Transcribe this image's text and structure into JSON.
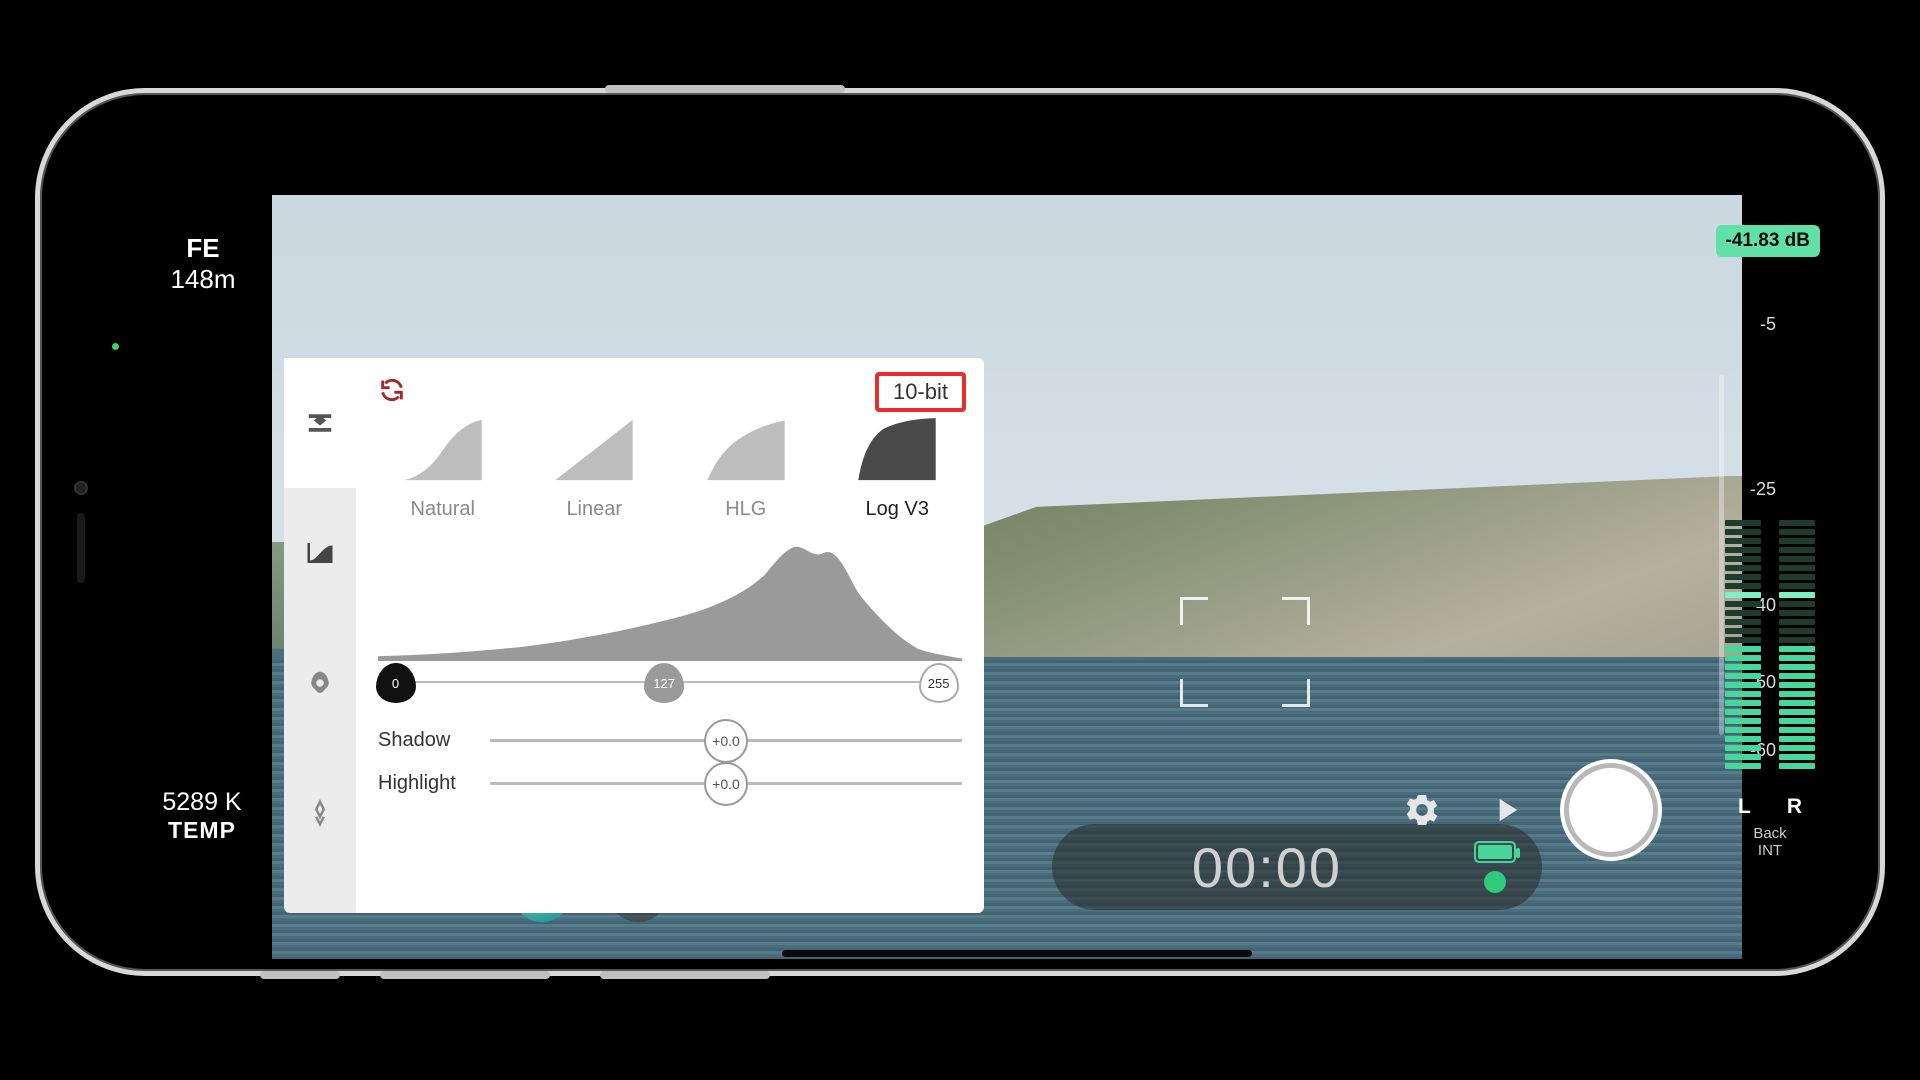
{
  "left": {
    "fe": "FE",
    "distance": "148m",
    "kelvin": "5289 K",
    "kelvin_label": "TEMP"
  },
  "audio": {
    "db_badge": "-41.83 dB",
    "ticks": {
      "t5": "-5",
      "t25": "-25",
      "t40": "-40",
      "t50": "-50",
      "t60": "-60"
    },
    "ch_left": "L",
    "ch_right": "R",
    "source_line1": "Back",
    "source_line2": "INT"
  },
  "time": {
    "code": "00:00"
  },
  "panel": {
    "bit_badge": "10-bit",
    "curves": {
      "natural": "Natural",
      "linear": "Linear",
      "hlg": "HLG",
      "logv3": "Log V3"
    },
    "pins": {
      "black": "0",
      "mid": "127",
      "white": "255"
    },
    "shadow_label": "Shadow",
    "shadow_val": "+0.0",
    "highlight_label": "Highlight",
    "highlight_val": "+0.0"
  }
}
